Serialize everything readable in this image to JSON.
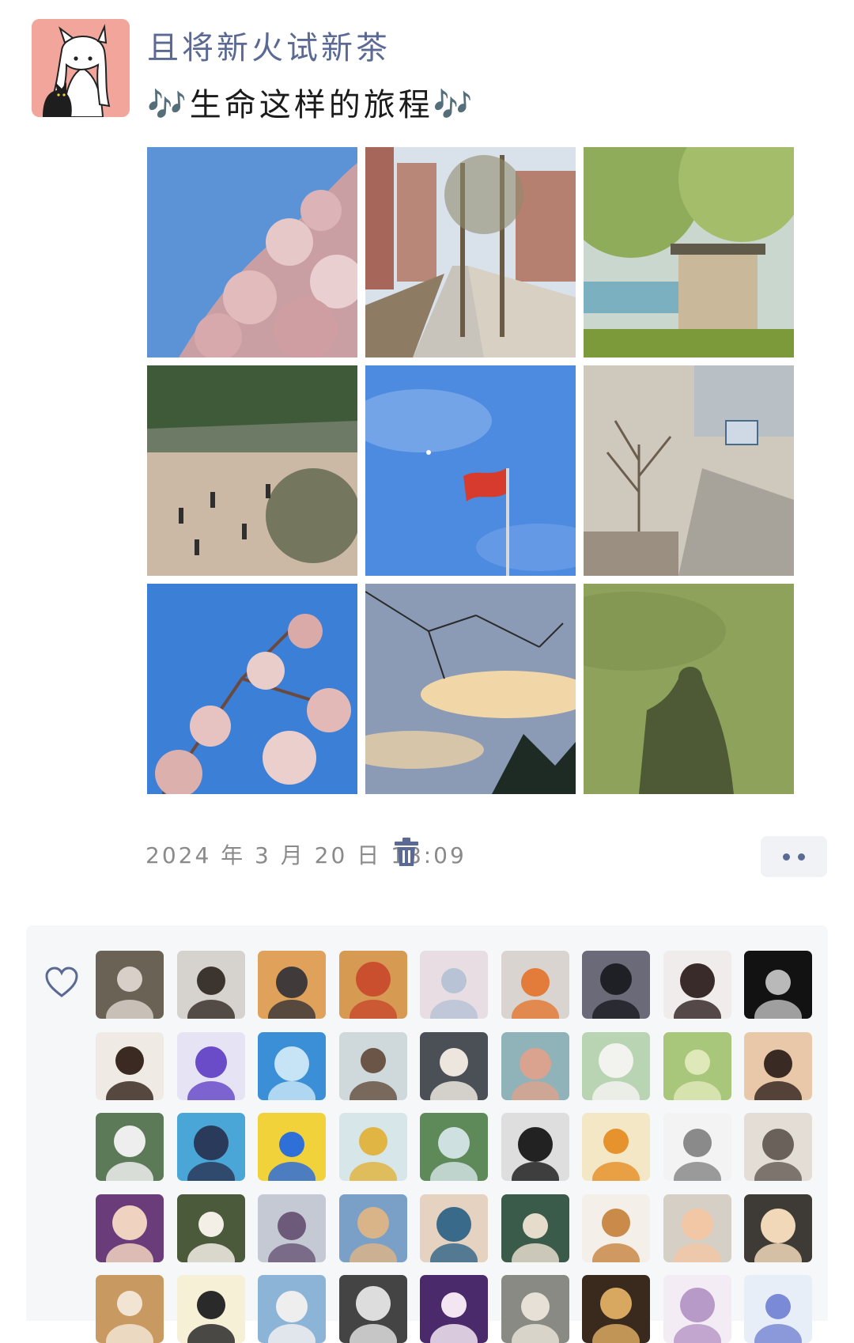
{
  "post": {
    "author": {
      "name": "且将新火试新茶",
      "avatar_icon": "anime-girl-with-black-cat-avatar",
      "avatar_bg": "#f1a59b"
    },
    "caption": "🎶生命这样的旅程🎶",
    "timestamp": "2024 年 3 月 20 日 18:09",
    "delete_icon": "trash-icon",
    "more_icon": "more-dots-icon"
  },
  "photos": [
    {
      "subject": "magnolia blossoms against blue sky",
      "palette": [
        "#5b93d6",
        "#e7c8c8"
      ]
    },
    {
      "subject": "campus path between brick buildings",
      "palette": [
        "#b78d83",
        "#8e7b63"
      ]
    },
    {
      "subject": "pine trees and small wooden hut",
      "palette": [
        "#9ab06a",
        "#c9c5ae"
      ]
    },
    {
      "subject": "campus plaza with people walking",
      "palette": [
        "#cab8a8",
        "#3f5a39"
      ]
    },
    {
      "subject": "red flag on flagpole in blue sky",
      "palette": [
        "#4d8be0",
        "#d73b2e"
      ]
    },
    {
      "subject": "bare trees along road with bus",
      "palette": [
        "#c9c2b7",
        "#8b7e6e"
      ]
    },
    {
      "subject": "magnolia branches against blue sky",
      "palette": [
        "#3c7fd6",
        "#e6c3c1"
      ]
    },
    {
      "subject": "tree branches silhouetted against evening sky",
      "palette": [
        "#8b9bb6",
        "#f1d6a8"
      ]
    },
    {
      "subject": "shadow of person on grass",
      "palette": [
        "#8ea25c",
        "#4d5a35"
      ]
    }
  ],
  "likes": {
    "heart_icon": "heart-outline-icon",
    "avatars": [
      {
        "icon": "person-with-helmet-avatar",
        "colors": [
          "#6b6256",
          "#d8d0c8"
        ]
      },
      {
        "icon": "smiling-woman-avatar",
        "colors": [
          "#d6d2cd",
          "#3c342e"
        ]
      },
      {
        "icon": "panda-sunset-avatar",
        "colors": [
          "#e0a25a",
          "#403a3a"
        ]
      },
      {
        "icon": "scream-painting-cat-avatar",
        "colors": [
          "#d79a52",
          "#c94f2f"
        ]
      },
      {
        "icon": "whale-in-sky-avatar",
        "colors": [
          "#e7dde2",
          "#b8c3d6"
        ]
      },
      {
        "icon": "child-with-panda-ears-avatar",
        "colors": [
          "#d9d4cf",
          "#e37b3a"
        ]
      },
      {
        "icon": "long-dark-hair-avatar",
        "colors": [
          "#6a6a78",
          "#1f1f26"
        ]
      },
      {
        "icon": "girl-portrait-avatar",
        "colors": [
          "#f0eceb",
          "#3a2b2b"
        ]
      },
      {
        "icon": "planet-in-space-avatar",
        "colors": [
          "#121212",
          "#b9b9b9"
        ]
      },
      {
        "icon": "puppy-face-avatar",
        "colors": [
          "#efeae3",
          "#3b2a22"
        ]
      },
      {
        "icon": "exam-anime-sticker-avatar",
        "colors": [
          "#e6e4f4",
          "#6a4cc9"
        ]
      },
      {
        "icon": "blue-graph-avatar",
        "colors": [
          "#3a8fd6",
          "#c6e4f6"
        ]
      },
      {
        "icon": "girl-at-sea-avatar",
        "colors": [
          "#cfd9dc",
          "#6a5546"
        ]
      },
      {
        "icon": "white-cat-avatar",
        "colors": [
          "#4b4f56",
          "#ece6de"
        ]
      },
      {
        "icon": "dancing-figures-avatar",
        "colors": [
          "#8fb3b8",
          "#d9a38f"
        ]
      },
      {
        "icon": "ink-painting-figure-avatar",
        "colors": [
          "#b9d4b2",
          "#f2f2ee"
        ]
      },
      {
        "icon": "forest-light-avatar",
        "colors": [
          "#a9c77a",
          "#dfe8b8"
        ]
      },
      {
        "icon": "cartoon-boy-glasses-avatar",
        "colors": [
          "#e8c8a8",
          "#3a2a24"
        ]
      },
      {
        "icon": "white-dog-outdoors-avatar",
        "colors": [
          "#5c7a58",
          "#eeeeee"
        ]
      },
      {
        "icon": "anime-girl-ocean-avatar",
        "colors": [
          "#4aa6d6",
          "#2a3a5a"
        ]
      },
      {
        "icon": "pikachu-avatar",
        "colors": [
          "#f2d23a",
          "#2e6fd8"
        ]
      },
      {
        "icon": "bird-figure-avatar",
        "colors": [
          "#d7e6e8",
          "#e0b544"
        ]
      },
      {
        "icon": "lake-and-trees-avatar",
        "colors": [
          "#5d8a58",
          "#cfe0e0"
        ]
      },
      {
        "icon": "dark-hair-silhouette-avatar",
        "colors": [
          "#dedede",
          "#222222"
        ]
      },
      {
        "icon": "winnie-and-tigger-avatar",
        "colors": [
          "#f4e7c6",
          "#e6932e"
        ]
      },
      {
        "icon": "cat-meme-avatar",
        "colors": [
          "#f3f3f3",
          "#8a8a8a"
        ]
      },
      {
        "icon": "lying-cat-avatar",
        "colors": [
          "#e3ddd6",
          "#6a625a"
        ]
      },
      {
        "icon": "cartoon-glasses-person-avatar",
        "colors": [
          "#6a3c7a",
          "#f0d2c0"
        ]
      },
      {
        "icon": "fluffy-puppy-avatar",
        "colors": [
          "#4b5a3a",
          "#f3eee6"
        ]
      },
      {
        "icon": "armored-warrior-avatar",
        "colors": [
          "#c4c9d3",
          "#6d5a7a"
        ]
      },
      {
        "icon": "crowned-anime-character-avatar",
        "colors": [
          "#7aa0c8",
          "#d9b488"
        ]
      },
      {
        "icon": "boy-in-clouds-avatar",
        "colors": [
          "#e6d2c0",
          "#3a6a8a"
        ]
      },
      {
        "icon": "person-with-headphones-avatar",
        "colors": [
          "#3a5a4a",
          "#e6dccc"
        ]
      },
      {
        "icon": "corgi-puppy-avatar",
        "colors": [
          "#f4efe8",
          "#c98a4a"
        ]
      },
      {
        "icon": "gray-cat-avatar",
        "colors": [
          "#d6cfc6",
          "#f2c7a6"
        ]
      },
      {
        "icon": "laughing-child-avatar",
        "colors": [
          "#3e3a36",
          "#f0d8b8"
        ]
      },
      {
        "icon": "orange-cat-avatar",
        "colors": [
          "#c89a62",
          "#f2e4d2"
        ]
      },
      {
        "icon": "round-doodle-face-avatar",
        "colors": [
          "#f6f1d6",
          "#2a2a2a"
        ]
      },
      {
        "icon": "child-in-hat-avatar",
        "colors": [
          "#8cb4d6",
          "#eeeeee"
        ]
      },
      {
        "icon": "black-and-white-sketch-avatar",
        "colors": [
          "#444444",
          "#dddddd"
        ]
      },
      {
        "icon": "purple-anime-eyes-avatar",
        "colors": [
          "#4a2a6a",
          "#f3e6f2"
        ]
      },
      {
        "icon": "cat-in-bag-avatar",
        "colors": [
          "#8a8a84",
          "#e6e0d6"
        ]
      },
      {
        "icon": "golden-puppy-avatar",
        "colors": [
          "#3a2a1e",
          "#d9a860"
        ]
      },
      {
        "icon": "anime-white-hair-avatar",
        "colors": [
          "#f3ecf4",
          "#b89ac8"
        ]
      },
      {
        "icon": "blue-anime-character-avatar",
        "colors": [
          "#e8eef8",
          "#7a8ad6"
        ]
      }
    ]
  }
}
